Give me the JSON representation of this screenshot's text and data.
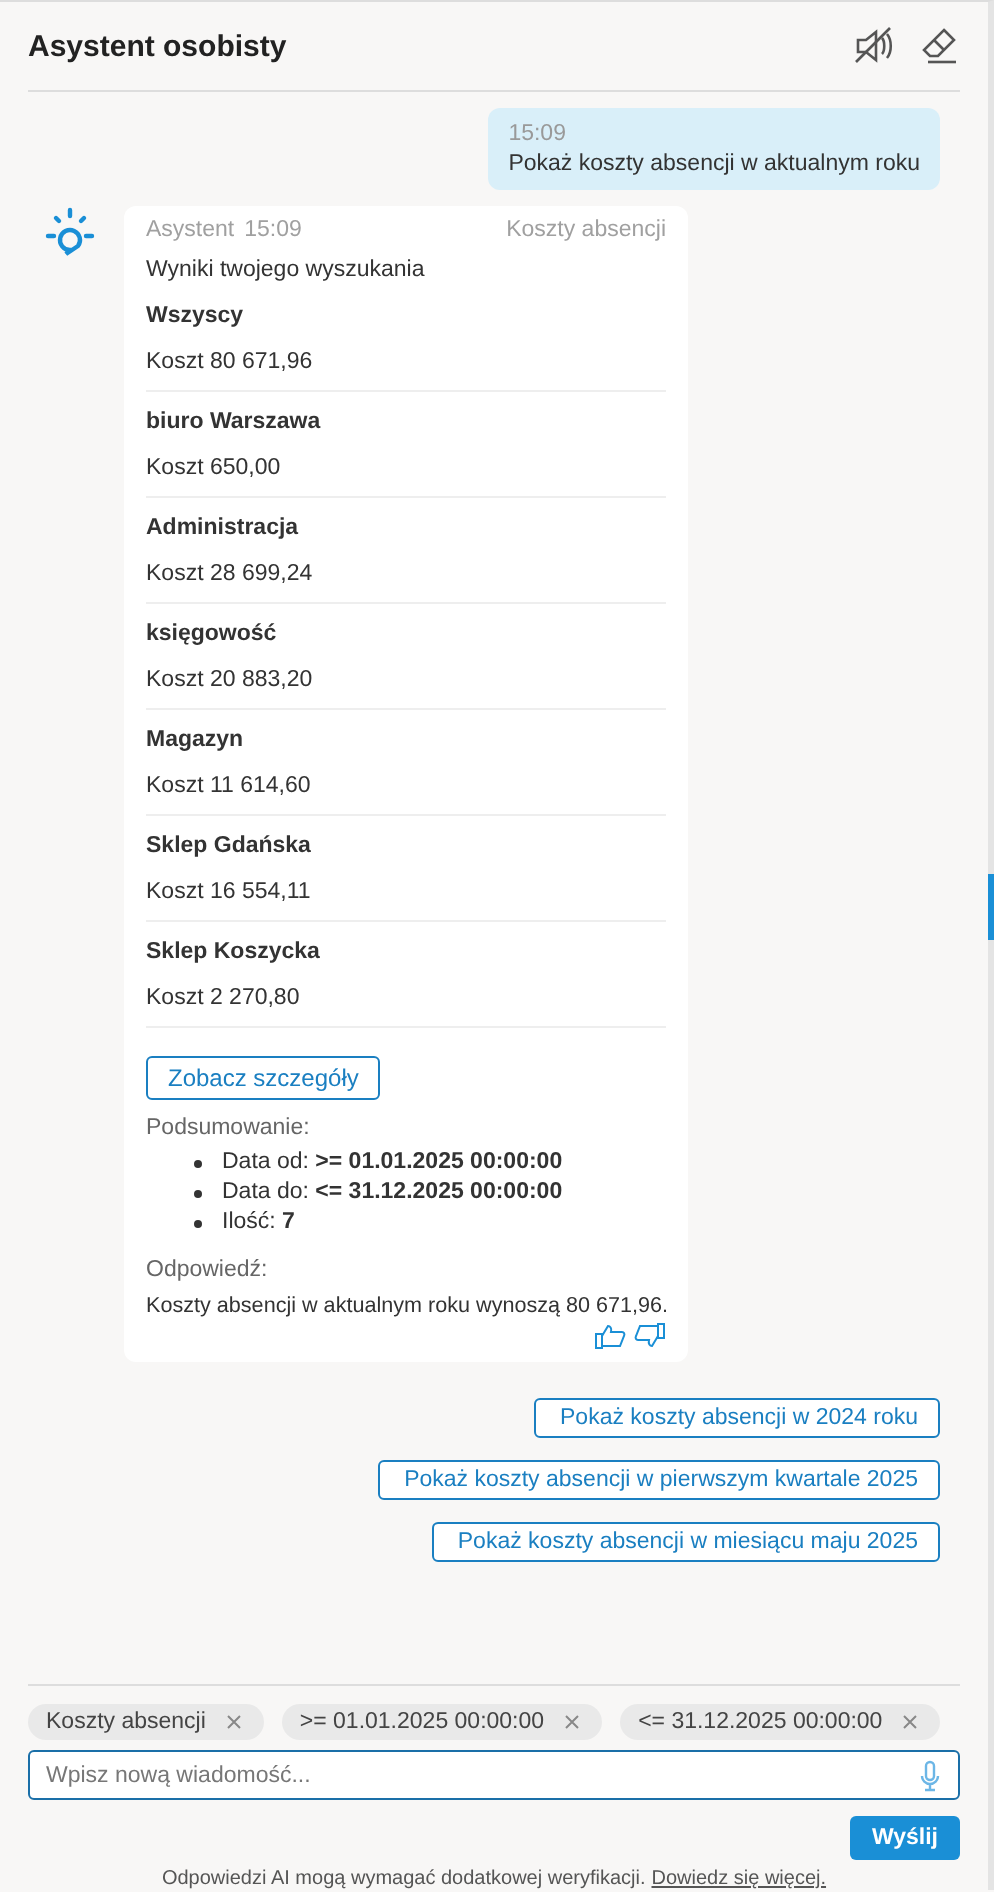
{
  "header": {
    "title": "Asystent osobisty"
  },
  "user_message": {
    "time": "15:09",
    "text": "Pokaż koszty absencji w aktualnym roku"
  },
  "assistant_message": {
    "sender": "Asystent",
    "time": "15:09",
    "topic": "Koszty absencji",
    "intro": "Wyniki twojego wyszukania",
    "results": [
      {
        "name": "Wszyscy",
        "cost": "Koszt 80 671,96"
      },
      {
        "name": "biuro Warszawa",
        "cost": "Koszt 650,00"
      },
      {
        "name": "Administracja",
        "cost": "Koszt 28 699,24"
      },
      {
        "name": "księgowość",
        "cost": "Koszt 20 883,20"
      },
      {
        "name": "Magazyn",
        "cost": "Koszt 11 614,60"
      },
      {
        "name": "Sklep Gdańska",
        "cost": "Koszt 16 554,11"
      },
      {
        "name": "Sklep Koszycka",
        "cost": "Koszt 2 270,80"
      }
    ],
    "details_button": "Zobacz szczegóły",
    "summary_label": "Podsumowanie:",
    "summary": [
      "Data od: **>= 01.01.2025 00:00:00**",
      "Data do: **<= 31.12.2025 00:00:00**",
      "Ilość: **7**"
    ],
    "answer_label": "Odpowiedź:",
    "answer": "Koszty absencji w aktualnym roku wynoszą 80 671,96."
  },
  "suggestions": [
    "Pokaż koszty absencji w 2024 roku",
    "Pokaż koszty absencji w pierwszym kwartale 2025",
    "Pokaż koszty absencji w miesiącu maju 2025"
  ],
  "filters": [
    "Koszty absencji",
    ">= 01.01.2025 00:00:00",
    "<= 31.12.2025 00:00:00"
  ],
  "input": {
    "placeholder": "Wpisz nową wiadomość..."
  },
  "send_button": "Wyślij",
  "footer": {
    "text": "Odpowiedzi AI mogą wymagać dodatkowej weryfikacji.",
    "link": "Dowiedz się więcej."
  }
}
